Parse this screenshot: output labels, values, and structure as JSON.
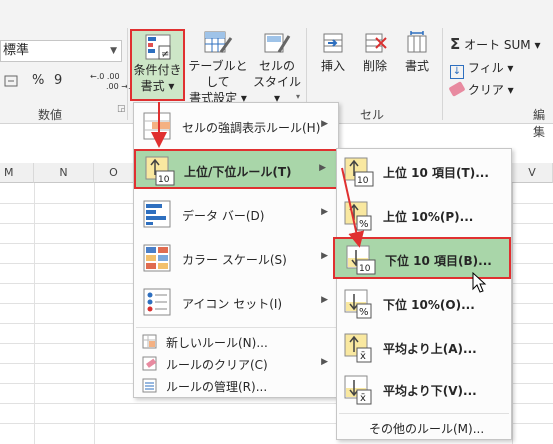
{
  "ribbon": {
    "number_format_value": "標準",
    "number_buttons": [
      "%",
      "9"
    ],
    "decimal_up": "←.0 .00",
    "decimal_down": ".00 →.0",
    "group_number": "数値",
    "group_cells": "セル",
    "group_edit": "編集",
    "cond_format": [
      "条件付き",
      "書式 ▾"
    ],
    "table_format": [
      "テーブルとして",
      "書式設定 ▾"
    ],
    "cell_style": [
      "セルの",
      "スタイル ▾"
    ],
    "insert": "挿入",
    "delete": "削除",
    "format": "書式",
    "autosum": "オート SUM ▾",
    "fill": "フィル ▾",
    "clear": "クリア ▾",
    "small_arrows": [
      "▾",
      "▾",
      "▾"
    ]
  },
  "columns": [
    "M",
    "N",
    "O",
    "V"
  ],
  "menu1": {
    "items": [
      {
        "label": "セルの強調表示ルール(H)",
        "icon": "highlight-cells-icon"
      },
      {
        "label": "上位/下位ルール(T)",
        "icon": "top-bottom-icon"
      },
      {
        "label": "データ バー(D)",
        "icon": "data-bars-icon"
      },
      {
        "label": "カラー スケール(S)",
        "icon": "color-scale-icon"
      },
      {
        "label": "アイコン セット(I)",
        "icon": "icon-sets-icon"
      }
    ],
    "small_items": [
      {
        "label": "新しいルール(N)..."
      },
      {
        "label": "ルールのクリア(C)"
      },
      {
        "label": "ルールの管理(R)..."
      }
    ]
  },
  "menu2": {
    "items": [
      {
        "label": "上位 10 項目(T)...",
        "badge": "10"
      },
      {
        "label": "上位 10%(P)...",
        "badge": "%"
      },
      {
        "label": "下位 10 項目(B)...",
        "badge": "10"
      },
      {
        "label": "下位 10%(O)...",
        "badge": "%"
      },
      {
        "label": "平均より上(A)...",
        "badge": "x̄"
      },
      {
        "label": "平均より下(V)...",
        "badge": "x̄"
      }
    ],
    "more_rules": "その他のルール(M)..."
  },
  "colors": {
    "highlight": "#a9d6a9",
    "annotation_red": "#e03030",
    "accent_blue": "#2e6fbf"
  }
}
